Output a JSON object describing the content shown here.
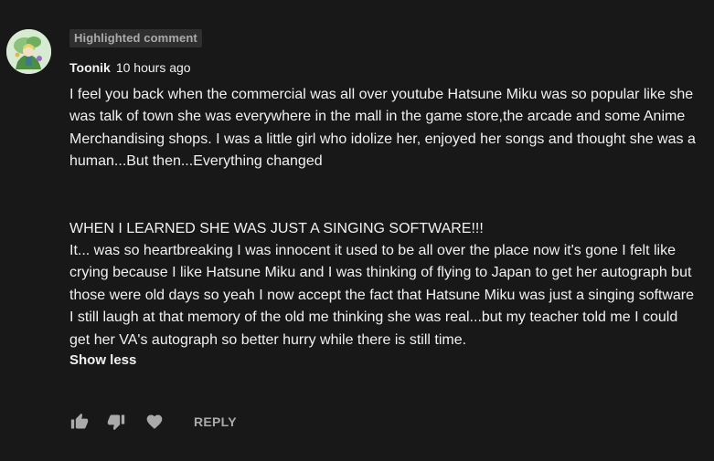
{
  "comment": {
    "badge": "Highlighted comment",
    "author": "Toonik",
    "timestamp": "10 hours ago",
    "avatar_icon": "avatar-icon",
    "paragraph1": "I feel you back when the commercial was all over youtube Hatsune Miku was so popular like she was talk of town she was everywhere in the mall in the game store,the arcade and some Anime Merchandising shops. I was a little girl who idolize her, enjoyed her songs and thought she was a human...But then...Everything changed",
    "paragraph2_line1": "WHEN I LEARNED SHE WAS JUST A SINGING SOFTWARE!!!",
    "paragraph2_rest": "It... was so heartbreaking I was innocent it used to be all over the place now it's gone I felt like crying because I like Hatsune Miku and I was thinking of flying to Japan to get her autograph but those were old days so yeah I now accept the fact that Hatsune Miku was just a singing software I still laugh at that memory of the old me thinking she was real...but my teacher told me I could get her VA's autograph so better hurry while there is still time.",
    "show_less": "Show less"
  },
  "actions": {
    "like_icon": "thumbs-up-icon",
    "dislike_icon": "thumbs-down-icon",
    "heart_icon": "heart-icon",
    "reply": "REPLY"
  },
  "colors": {
    "background": "#181818",
    "text": "#f1f1f1",
    "secondary": "#aaaaaa",
    "badge_bg": "#2f2f2f"
  }
}
